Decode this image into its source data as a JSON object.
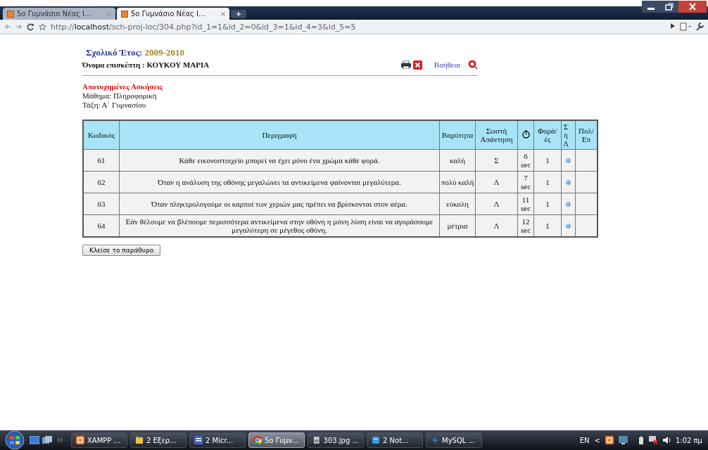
{
  "browser": {
    "tabs": [
      {
        "label": "5o Γυμνάσιο Νέας I...",
        "selected": false
      },
      {
        "label": "5o Γυμνάσιο Νέας I...",
        "selected": true
      }
    ],
    "url": "http://**localhost**/sch-proj-loc/304.php?id_1=1&id_2=0&id_3=1&id_4=3&id_5=5"
  },
  "header": {
    "year_label": "Σχολικό Έτος:",
    "year_value": "2009-2010",
    "visitor": "Όνομα επισκέπτη : ΚΟΥΚΟΥ ΜΑΡΙΑ",
    "help_link": "Βοήθεια"
  },
  "section": {
    "title": "Αποτυχημένες Ασκήσεις",
    "subject": "Μάθημα: Πληροφορική",
    "class": "Τάξη: Α΄ Γυμνασίου"
  },
  "table": {
    "columns": [
      {
        "label": "Κωδικός",
        "kind": "text"
      },
      {
        "label": "Περιγραφή",
        "kind": "text"
      },
      {
        "label": "Βαρύτητα",
        "kind": "text"
      },
      {
        "label": "Σωστή Απάντηση",
        "kind": "text"
      },
      {
        "kind": "clock"
      },
      {
        "label": "Φορά/ές",
        "kind": "text"
      },
      {
        "label": "Σ ή Λ",
        "kind": "stack"
      },
      {
        "label": "Πολ/Επ",
        "kind": "text"
      }
    ],
    "rows": [
      {
        "code": "61",
        "description": "Κάθε εικονοστοιχείο μπορεί να έχει μόνο ένα χρώμα κάθε φορά.",
        "weight": "καλή",
        "answer": "Σ",
        "time": "6 sec",
        "times": "1"
      },
      {
        "code": "62",
        "description": "Όταν η ανάλυση της οθόνης μεγαλώνει τα αντικείμενα φαίνονται μεγαλύτερα.",
        "weight": "πολύ καλή",
        "answer": "Λ",
        "time": "7 sec",
        "times": "1"
      },
      {
        "code": "63",
        "description": "Όταν πληκτρολογούμε οι καρποί των χεριών μας πρέπει να βρίσκονται στον αέρα.",
        "weight": "εύκολη",
        "answer": "Λ",
        "time": "11 sec",
        "times": "1"
      },
      {
        "code": "64",
        "description": "Εάν θέλουμε να βλέπουμε περισσότερα αντικείμενα στην οθόνη η μόνη λύση είναι να αγοράσουμε μεγαλύτερη σε μέγεθος οθόνη.",
        "weight": "μέτρια",
        "answer": "Λ",
        "time": "12 sec",
        "times": "1"
      }
    ]
  },
  "close_button": "Κλείσε το παράθυρο",
  "taskbar": {
    "items": [
      {
        "label": "XAMPP ...",
        "kind": "xampp",
        "selected": false
      },
      {
        "label": "2 Εξερ...",
        "kind": "folder",
        "selected": false
      },
      {
        "label": "2 Micr...",
        "kind": "word",
        "selected": false
      },
      {
        "label": "5o Γυμν...",
        "kind": "chrome",
        "selected": true
      },
      {
        "label": "303.jpg ...",
        "kind": "image",
        "selected": false
      },
      {
        "label": "2 Not...",
        "kind": "notes",
        "selected": false
      },
      {
        "label": "MySQL ...",
        "kind": "mysql",
        "selected": false
      }
    ],
    "language": "EN",
    "tray_expander": "<",
    "clock": "1:02 πμ"
  }
}
